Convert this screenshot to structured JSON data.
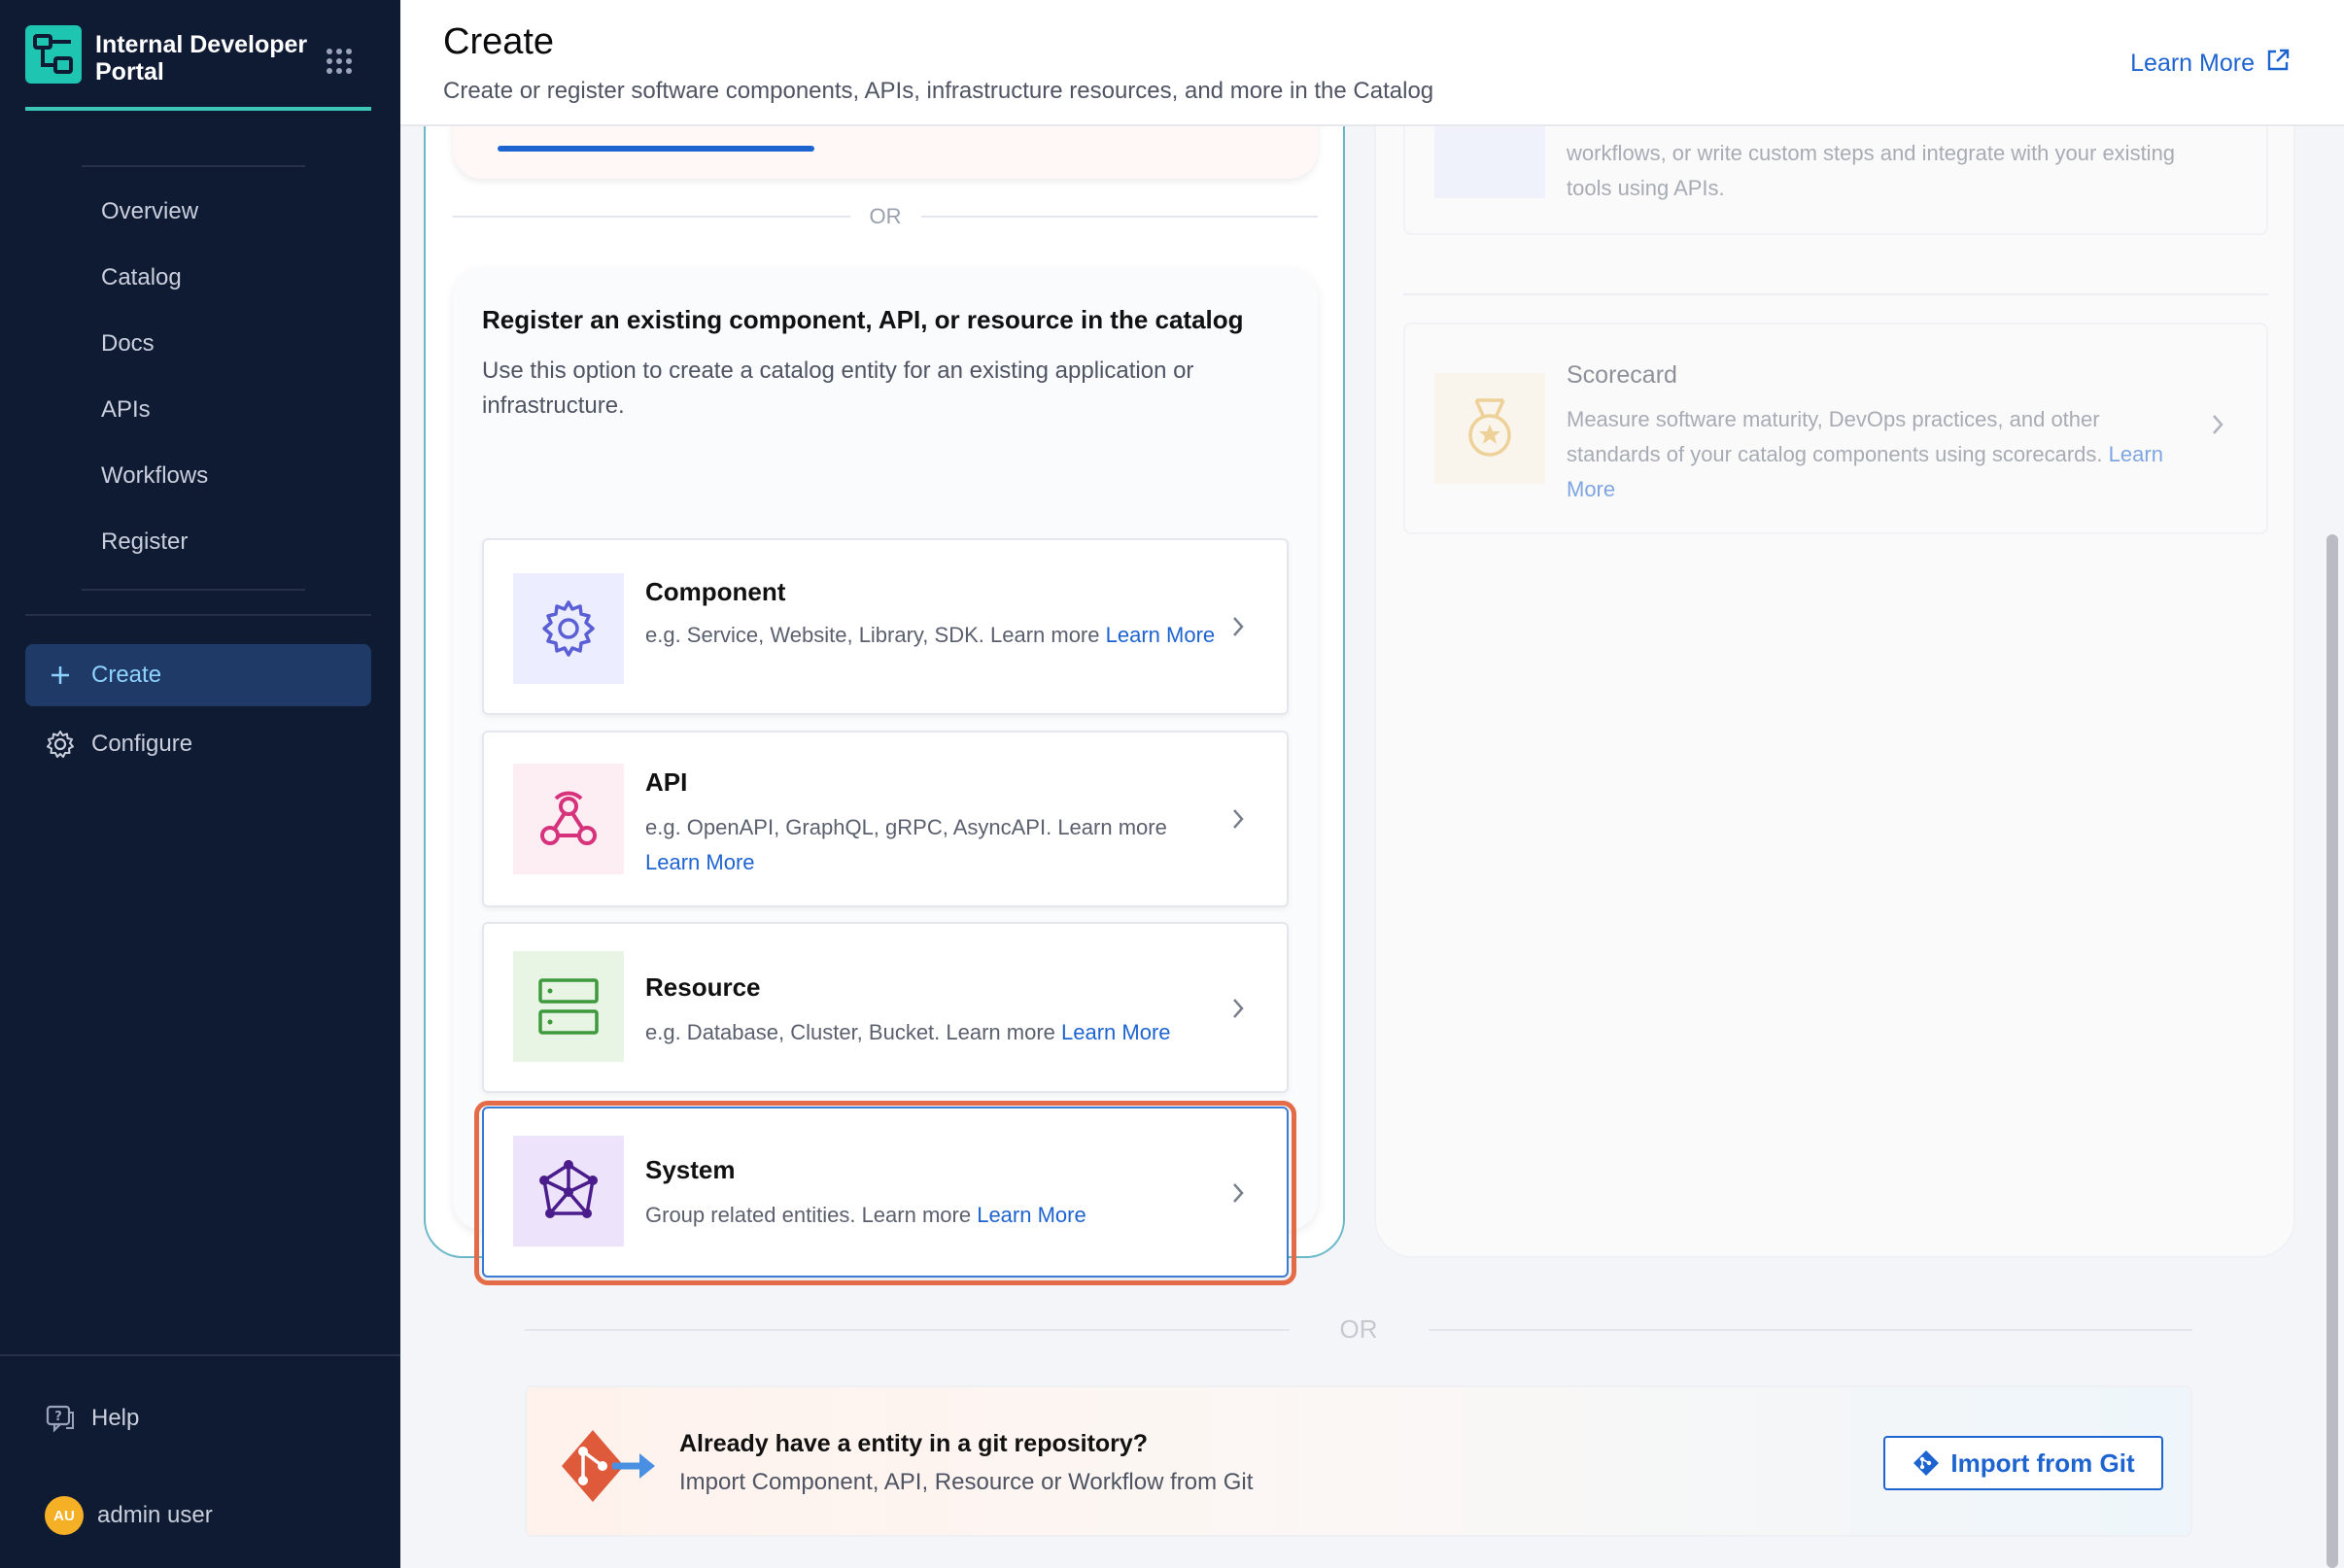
{
  "sidebar": {
    "brand_title": "Internal Developer Portal",
    "nav_items": [
      {
        "label": "Overview"
      },
      {
        "label": "Catalog"
      },
      {
        "label": "Docs"
      },
      {
        "label": "APIs"
      },
      {
        "label": "Workflows"
      },
      {
        "label": "Register"
      }
    ],
    "create_label": "Create",
    "configure_label": "Configure",
    "help_label": "Help",
    "user_initials": "AU",
    "user_name": "admin user"
  },
  "header": {
    "title": "Create",
    "subtitle": "Create or register software components, APIs, infrastructure resources, and more in the Catalog",
    "learn_more": "Learn More"
  },
  "left_panel": {
    "or_label": "OR",
    "register_title": "Register an existing component, API, or resource in the catalog",
    "register_desc": "Use this option to create a catalog entity for an existing application or infrastructure.",
    "cards": {
      "component": {
        "title": "Component",
        "desc": "e.g. Service, Website, Library, SDK. Learn more",
        "link": "Learn More"
      },
      "api": {
        "title": "API",
        "desc": "e.g. OpenAPI, GraphQL, gRPC, AsyncAPI. Learn more",
        "link": "Learn More"
      },
      "resource": {
        "title": "Resource",
        "desc": "e.g. Database, Cluster, Bucket. Learn more",
        "link": "Learn More"
      },
      "system": {
        "title": "System",
        "desc": "Group related entities. Learn more",
        "link": "Learn More"
      }
    }
  },
  "right_panel": {
    "top_text": "workflows, or write custom steps and integrate with your existing tools using APIs.",
    "scorecard": {
      "title": "Scorecard",
      "desc": "Measure software maturity, DevOps practices, and other standards of your catalog components using scorecards.",
      "link": "Learn More"
    }
  },
  "bottom": {
    "or_label": "OR",
    "git_title": "Already have a entity in a git repository?",
    "git_desc": "Import Component, API, Resource or Workflow from Git",
    "import_label": "Import from Git"
  },
  "colors": {
    "sidebar_bg": "#0f1a33",
    "accent": "#1e64d1",
    "highlight": "#e46b47",
    "brand": "#1ec6b2"
  }
}
